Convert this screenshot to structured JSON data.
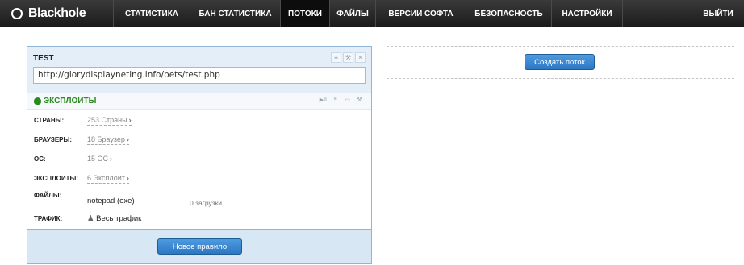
{
  "app": {
    "logo_text": "Blackhole"
  },
  "nav": {
    "items": [
      {
        "label": "СТАТИСТИКА"
      },
      {
        "label": "БАН СТАТИСТИКА"
      },
      {
        "label": "ПОТОКИ"
      },
      {
        "label": "ФАЙЛЫ"
      },
      {
        "label": "ВЕРСИИ СОФТА"
      },
      {
        "label": "БЕЗОПАСНОСТЬ"
      },
      {
        "label": "НАСТРОЙКИ"
      }
    ],
    "active": "ПОТОКИ",
    "logout_label": "ВЫЙТИ"
  },
  "stream": {
    "title": "TEST",
    "url": "http://glorydisplayneting.info/bets/test.php",
    "exploits_title": "ЭКСПЛОИТЫ",
    "rows": {
      "countries": {
        "label": "СТРАНЫ:",
        "value": "253 Страны",
        "chevron": "›"
      },
      "browsers": {
        "label": "БРАУЗЕРЫ:",
        "value": "18 Браузер",
        "chevron": "›"
      },
      "os": {
        "label": "ОС:",
        "value": "15 ОС",
        "chevron": "›"
      },
      "exploits": {
        "label": "ЭКСПЛОИТЫ:",
        "value": "6 Эксплоит",
        "chevron": "›"
      },
      "files": {
        "label": "ФАЙЛЫ:",
        "file": "notepad (exe)",
        "downloads": "0 загрузки"
      },
      "traffic": {
        "label": "ТРАФИК:",
        "value": "Весь трафик"
      }
    },
    "new_rule_button": "Новое правило"
  },
  "create_stream_button": "Создать поток",
  "colors": {
    "accent_blue": "#2c77c4",
    "panel_bg": "#e3eef8",
    "panel_border": "#8fb6d9",
    "exploits_green": "#2a8a1f",
    "nav_bg": "#1b1b1b"
  }
}
